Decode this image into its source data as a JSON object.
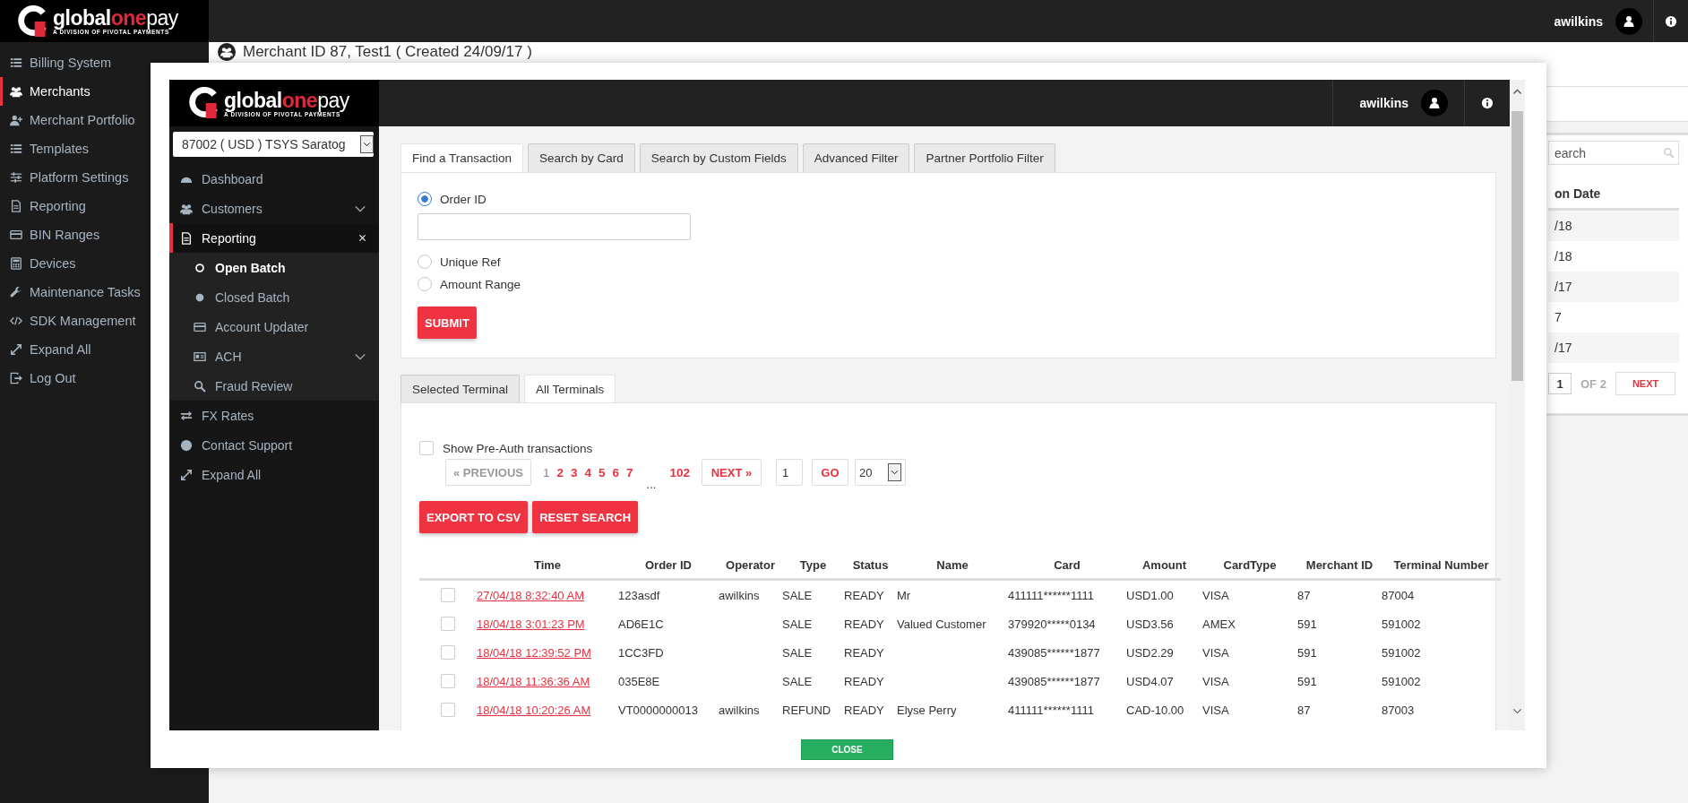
{
  "header": {
    "logo": {
      "parts": [
        {
          "text": "global",
          "accent": false
        },
        {
          "text": "one",
          "accent": true
        },
        {
          "text": "pay",
          "accent": false
        }
      ],
      "tagline": "A DIVISION OF PIVOTAL PAYMENTS"
    },
    "user": "awilkins"
  },
  "sidebar": {
    "items": [
      {
        "label": "Billing System",
        "selected": false
      },
      {
        "label": "Merchants",
        "selected": true
      },
      {
        "label": "Merchant Portfolio",
        "selected": false
      },
      {
        "label": "Templates",
        "selected": false
      },
      {
        "label": "Platform Settings",
        "selected": false
      },
      {
        "label": "Reporting",
        "selected": false
      },
      {
        "label": "BIN Ranges",
        "selected": false
      },
      {
        "label": "Devices",
        "selected": false
      },
      {
        "label": "Maintenance Tasks",
        "selected": false
      },
      {
        "label": "SDK Management",
        "selected": false
      },
      {
        "label": "Expand All",
        "selected": false
      },
      {
        "label": "Log Out",
        "selected": false
      }
    ]
  },
  "page": {
    "title": "Merchant ID 87, Test1 ( Created 24/09/17 )",
    "search": {
      "placeholder": "earch"
    },
    "table": {
      "columns": [
        "on Date"
      ],
      "rows": [
        "/18",
        "/18",
        "/17",
        "7",
        "/17"
      ]
    },
    "pager": {
      "page": "1",
      "of": "OF 2",
      "next": "NEXT"
    }
  },
  "modal": {
    "header": {
      "logo": {
        "parts": [
          {
            "text": "global",
            "accent": false
          },
          {
            "text": "one",
            "accent": true
          },
          {
            "text": "pay",
            "accent": false
          }
        ],
        "tagline": "A DIVISION OF PIVOTAL PAYMENTS"
      },
      "user": "awilkins"
    },
    "merchant_select": {
      "value": "87002 ( USD ) TSYS Saratog"
    },
    "nav": {
      "items": [
        {
          "label": "Dashboard",
          "selected": false
        },
        {
          "label": "Customers",
          "selected": false,
          "expanded": false
        },
        {
          "label": "Reporting",
          "selected": true,
          "expanded": true,
          "children": [
            {
              "label": "Open Batch",
              "selected": true
            },
            {
              "label": "Closed Batch",
              "selected": false
            },
            {
              "label": "Account Updater",
              "selected": false
            },
            {
              "label": "ACH",
              "selected": false,
              "expanded": false
            },
            {
              "label": "Fraud Review",
              "selected": false
            }
          ]
        },
        {
          "label": "FX Rates",
          "selected": false
        },
        {
          "label": "Contact Support",
          "selected": false
        },
        {
          "label": "Expand All",
          "selected": false
        }
      ]
    },
    "search_tabs": [
      {
        "label": "Find a Transaction",
        "selected": true
      },
      {
        "label": "Search by Card",
        "selected": false
      },
      {
        "label": "Search by Custom Fields",
        "selected": false
      },
      {
        "label": "Advanced Filter",
        "selected": false
      },
      {
        "label": "Partner Portfolio Filter",
        "selected": false
      }
    ],
    "search_options": [
      {
        "label": "Order ID",
        "selected": true,
        "kind": "field"
      },
      {
        "label": "Unique Ref",
        "selected": false,
        "kind": "plain"
      },
      {
        "label": "Amount Range",
        "selected": false,
        "kind": "plain"
      }
    ],
    "submit": "SUBMIT",
    "terminal_tabs": [
      {
        "label": "Selected Terminal",
        "selected": false
      },
      {
        "label": "All Terminals",
        "selected": true
      }
    ],
    "pre_auth": {
      "label": "Show Pre-Auth transactions",
      "checked": false
    },
    "pagination": {
      "previous": {
        "label": "« PREVIOUS",
        "disabled": true
      },
      "pages": [
        {
          "label": "1",
          "kind": "page",
          "current": true
        },
        {
          "label": "2",
          "kind": "page",
          "current": false
        },
        {
          "label": "3",
          "kind": "page",
          "current": false
        },
        {
          "label": "4",
          "kind": "page",
          "current": false
        },
        {
          "label": "5",
          "kind": "page",
          "current": false
        },
        {
          "label": "6",
          "kind": "page",
          "current": false
        },
        {
          "label": "7",
          "kind": "page",
          "current": false
        },
        {
          "label": "...",
          "kind": "ellipsis"
        },
        {
          "label": "102",
          "kind": "page",
          "current": false
        }
      ],
      "next": "NEXT »",
      "page_input": "1",
      "go": "GO",
      "per_page": "20"
    },
    "actions": [
      "EXPORT TO CSV",
      "RESET SEARCH"
    ],
    "table": {
      "columns": [
        "Time",
        "Order ID",
        "Operator",
        "Type",
        "Status",
        "Name",
        "Card",
        "Amount",
        "CardType",
        "Merchant ID",
        "Terminal Number"
      ],
      "rows": [
        {
          "checked": false,
          "cells": [
            "27/04/18 8:32:40 AM",
            "123asdf",
            "awilkins",
            "SALE",
            "READY",
            "Mr",
            "411111******1111",
            "USD1.00",
            "VISA",
            "87",
            "87004"
          ]
        },
        {
          "checked": false,
          "cells": [
            "18/04/18 3:01:23 PM",
            "AD6E1C",
            null,
            "SALE",
            "READY",
            "Valued Customer",
            "379920*****0134",
            "USD3.56",
            "AMEX",
            "591",
            "591002"
          ]
        },
        {
          "checked": false,
          "cells": [
            "18/04/18 12:39:52 PM",
            "1CC3FD",
            null,
            "SALE",
            "READY",
            null,
            "439085******1877",
            "USD2.29",
            "VISA",
            "591",
            "591002"
          ]
        },
        {
          "checked": false,
          "cells": [
            "18/04/18 11:36:36 AM",
            "035E8E",
            null,
            "SALE",
            "READY",
            null,
            "439085******1877",
            "USD4.07",
            "VISA",
            "591",
            "591002"
          ]
        },
        {
          "checked": false,
          "cells": [
            "18/04/18 10:20:26 AM",
            "VT0000000013",
            "awilkins",
            "REFUND",
            "READY",
            "Elyse Perry",
            "411111******1111",
            "CAD-10.00",
            "VISA",
            "87",
            "87003"
          ]
        }
      ]
    },
    "close": "CLOSE"
  }
}
